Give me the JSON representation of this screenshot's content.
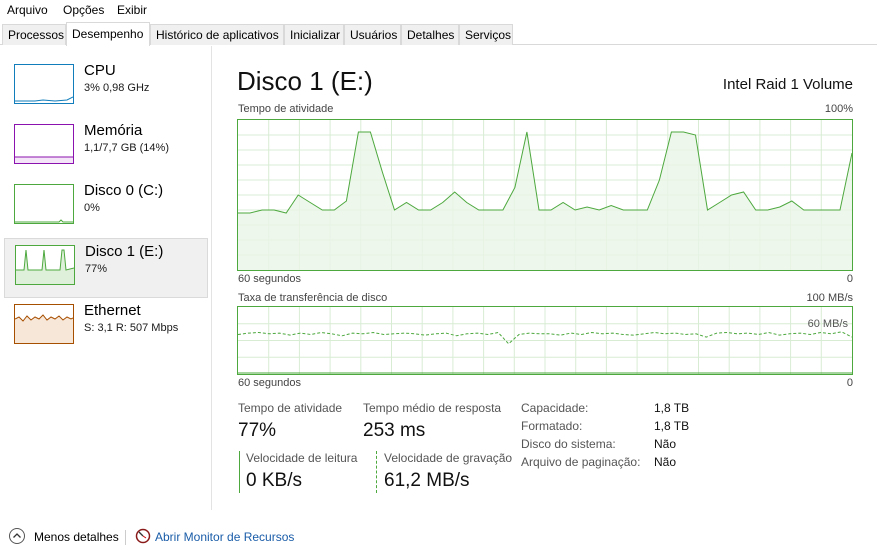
{
  "menu": [
    "Arquivo",
    "Opções",
    "Exibir"
  ],
  "tabs": [
    "Processos",
    "Desempenho",
    "Histórico de aplicativos",
    "Inicializar",
    "Usuários",
    "Detalhes",
    "Serviços"
  ],
  "active_tab": "Desempenho",
  "sidebar": {
    "items": [
      {
        "title": "CPU",
        "subtitle": "3% 0,98 GHz",
        "color": "#117dbb"
      },
      {
        "title": "Memória",
        "subtitle": "1,1/7,7 GB (14%)",
        "color": "#8b12ae"
      },
      {
        "title": "Disco 0 (C:)",
        "subtitle": "0%",
        "color": "#4da83e"
      },
      {
        "title": "Disco 1 (E:)",
        "subtitle": "77%",
        "color": "#4da83e",
        "selected": true
      },
      {
        "title": "Ethernet",
        "subtitle_s": "S:",
        "subtitle_s_val": "3,1",
        "subtitle_r": "R:",
        "subtitle_r_val": "507 Mbps",
        "color": "#a74f01"
      }
    ]
  },
  "main": {
    "title": "Disco 1 (E:)",
    "model": "Intel Raid 1 Volume",
    "activity_graph": {
      "label": "Tempo de atividade",
      "max_label": "100%",
      "time_left": "60 segundos",
      "time_right": "0",
      "values_percent": [
        38,
        38,
        40,
        40,
        38,
        50,
        45,
        40,
        40,
        46,
        92,
        92,
        65,
        40,
        45,
        40,
        40,
        45,
        52,
        45,
        40,
        40,
        40,
        55,
        92,
        40,
        40,
        45,
        40,
        42,
        40,
        43,
        40,
        40,
        40,
        60,
        92,
        92,
        90,
        40,
        45,
        50,
        52,
        40,
        40,
        42,
        46,
        40,
        40,
        40,
        40,
        78
      ]
    },
    "transfer_graph": {
      "label": "Taxa de transferência de disco",
      "max_label": "100 MB/s",
      "inner_label": "60 MB/s",
      "time_left": "60 segundos",
      "time_right": "0",
      "write_values_mbps": [
        59,
        61,
        62,
        60,
        61,
        58,
        61,
        59,
        62,
        60,
        57,
        61,
        60,
        62,
        59,
        60,
        61,
        60,
        58,
        60,
        61,
        57,
        60,
        61,
        59,
        62,
        45,
        59,
        61,
        60,
        60,
        58,
        61,
        59,
        62,
        60,
        61,
        59,
        58,
        60,
        62,
        60,
        61,
        59,
        60,
        55,
        61,
        62,
        60,
        61,
        59,
        62,
        58,
        60,
        61,
        59,
        62,
        60,
        63,
        55
      ],
      "read_values_mbps": [
        0,
        0,
        0,
        0,
        0,
        0,
        0,
        0,
        0,
        0,
        0,
        0,
        0,
        0,
        0,
        0,
        0,
        0,
        0,
        0,
        0,
        0,
        0,
        0,
        0,
        0,
        0,
        0,
        0,
        0,
        0,
        0,
        0,
        0,
        0,
        0,
        0,
        0,
        0,
        0,
        0,
        0,
        0,
        0,
        0,
        0,
        0,
        0,
        0,
        0,
        0,
        0,
        0,
        0,
        0,
        0,
        0,
        0,
        0,
        0
      ]
    },
    "stats": {
      "active_time_label": "Tempo de atividade",
      "active_time_value": "77%",
      "avg_response_label": "Tempo médio de resposta",
      "avg_response_value": "253 ms",
      "read_speed_label": "Velocidade de leitura",
      "read_speed_value": "0 KB/s",
      "write_speed_label": "Velocidade de gravação",
      "write_speed_value": "61,2 MB/s"
    },
    "properties": [
      {
        "label": "Capacidade:",
        "value": "1,8 TB"
      },
      {
        "label": "Formatado:",
        "value": "1,8 TB"
      },
      {
        "label": "Disco do sistema:",
        "value": "Não"
      },
      {
        "label": "Arquivo de paginação:",
        "value": "Não"
      }
    ]
  },
  "footer": {
    "less_details": "Menos detalhes",
    "open_monitor": "Abrir Monitor de Recursos"
  },
  "colors": {
    "disk_green": "#4da83e",
    "disk_fill": "#eaf5e7",
    "grid": "#d8ecd4",
    "link": "#1a5ca8"
  }
}
